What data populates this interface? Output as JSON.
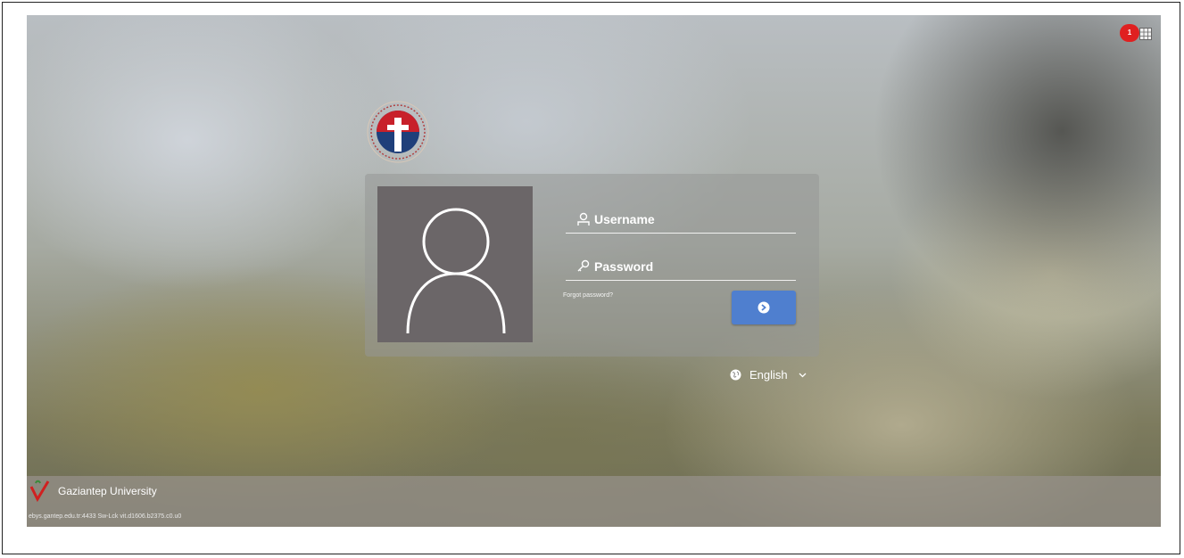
{
  "login": {
    "username_placeholder": "Username",
    "password_placeholder": "Password",
    "forgot_link": "Forgot password?"
  },
  "language": {
    "selected": "English"
  },
  "footer": {
    "university": "Gaziantep University",
    "status_url": "ebys.gantep.edu.tr:4433 Sw-Lck vit.d1606.b2375.c0.u0"
  },
  "notifications": {
    "count": "1"
  },
  "icons": {
    "user": "user-icon",
    "key": "key-icon",
    "login_arrow": "arrow-right-circle-icon",
    "globe": "globe-icon",
    "caret": "chevron-down-icon",
    "grid": "calendar-grid-icon"
  },
  "colors": {
    "login_button": "#4f7fcf",
    "avatar_bg": "#6b6668",
    "badge": "#e02020"
  }
}
